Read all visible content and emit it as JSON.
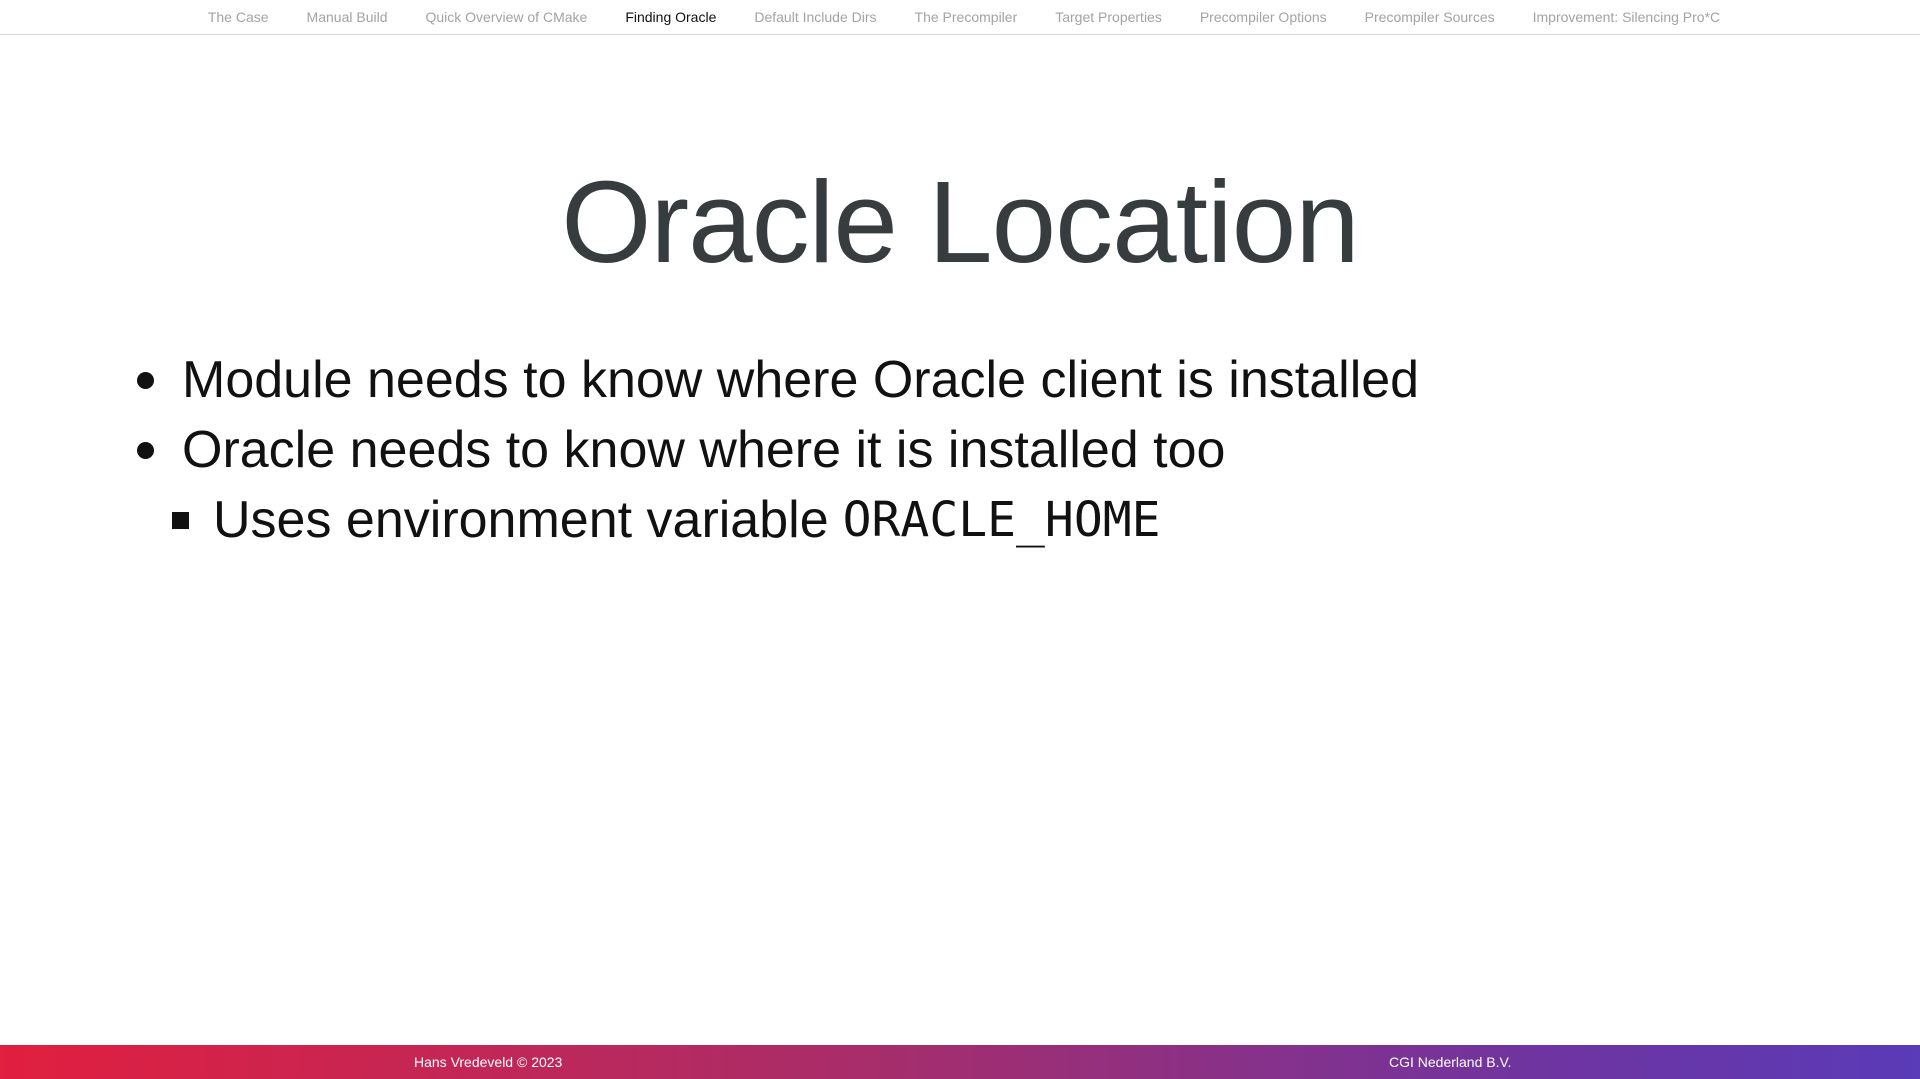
{
  "nav": {
    "items": [
      {
        "label": "The Case"
      },
      {
        "label": "Manual Build"
      },
      {
        "label": "Quick Overview of CMake"
      },
      {
        "label": "Finding Oracle"
      },
      {
        "label": "Default Include Dirs"
      },
      {
        "label": "The Precompiler"
      },
      {
        "label": "Target Properties"
      },
      {
        "label": "Precompiler Options"
      },
      {
        "label": "Precompiler Sources"
      },
      {
        "label": "Improvement: Silencing Pro*C"
      }
    ],
    "active_index": 3
  },
  "slide": {
    "title": "Oracle Location",
    "bullets": [
      "Module needs to know where Oracle client is installed",
      "Oracle needs to know where it is installed too"
    ],
    "sub_bullet": {
      "text": "Uses environment variable",
      "code": "ORACLE_HOME"
    }
  },
  "footer": {
    "left": "Hans Vredeveld © 2023",
    "right": "CGI Nederland B.V."
  },
  "colors": {
    "title": "#373d3f",
    "nav_inactive": "#a3a3a3",
    "nav_active": "#111111",
    "footer_gradient_start": "#e11f3f",
    "footer_gradient_end": "#5a3bb8"
  }
}
